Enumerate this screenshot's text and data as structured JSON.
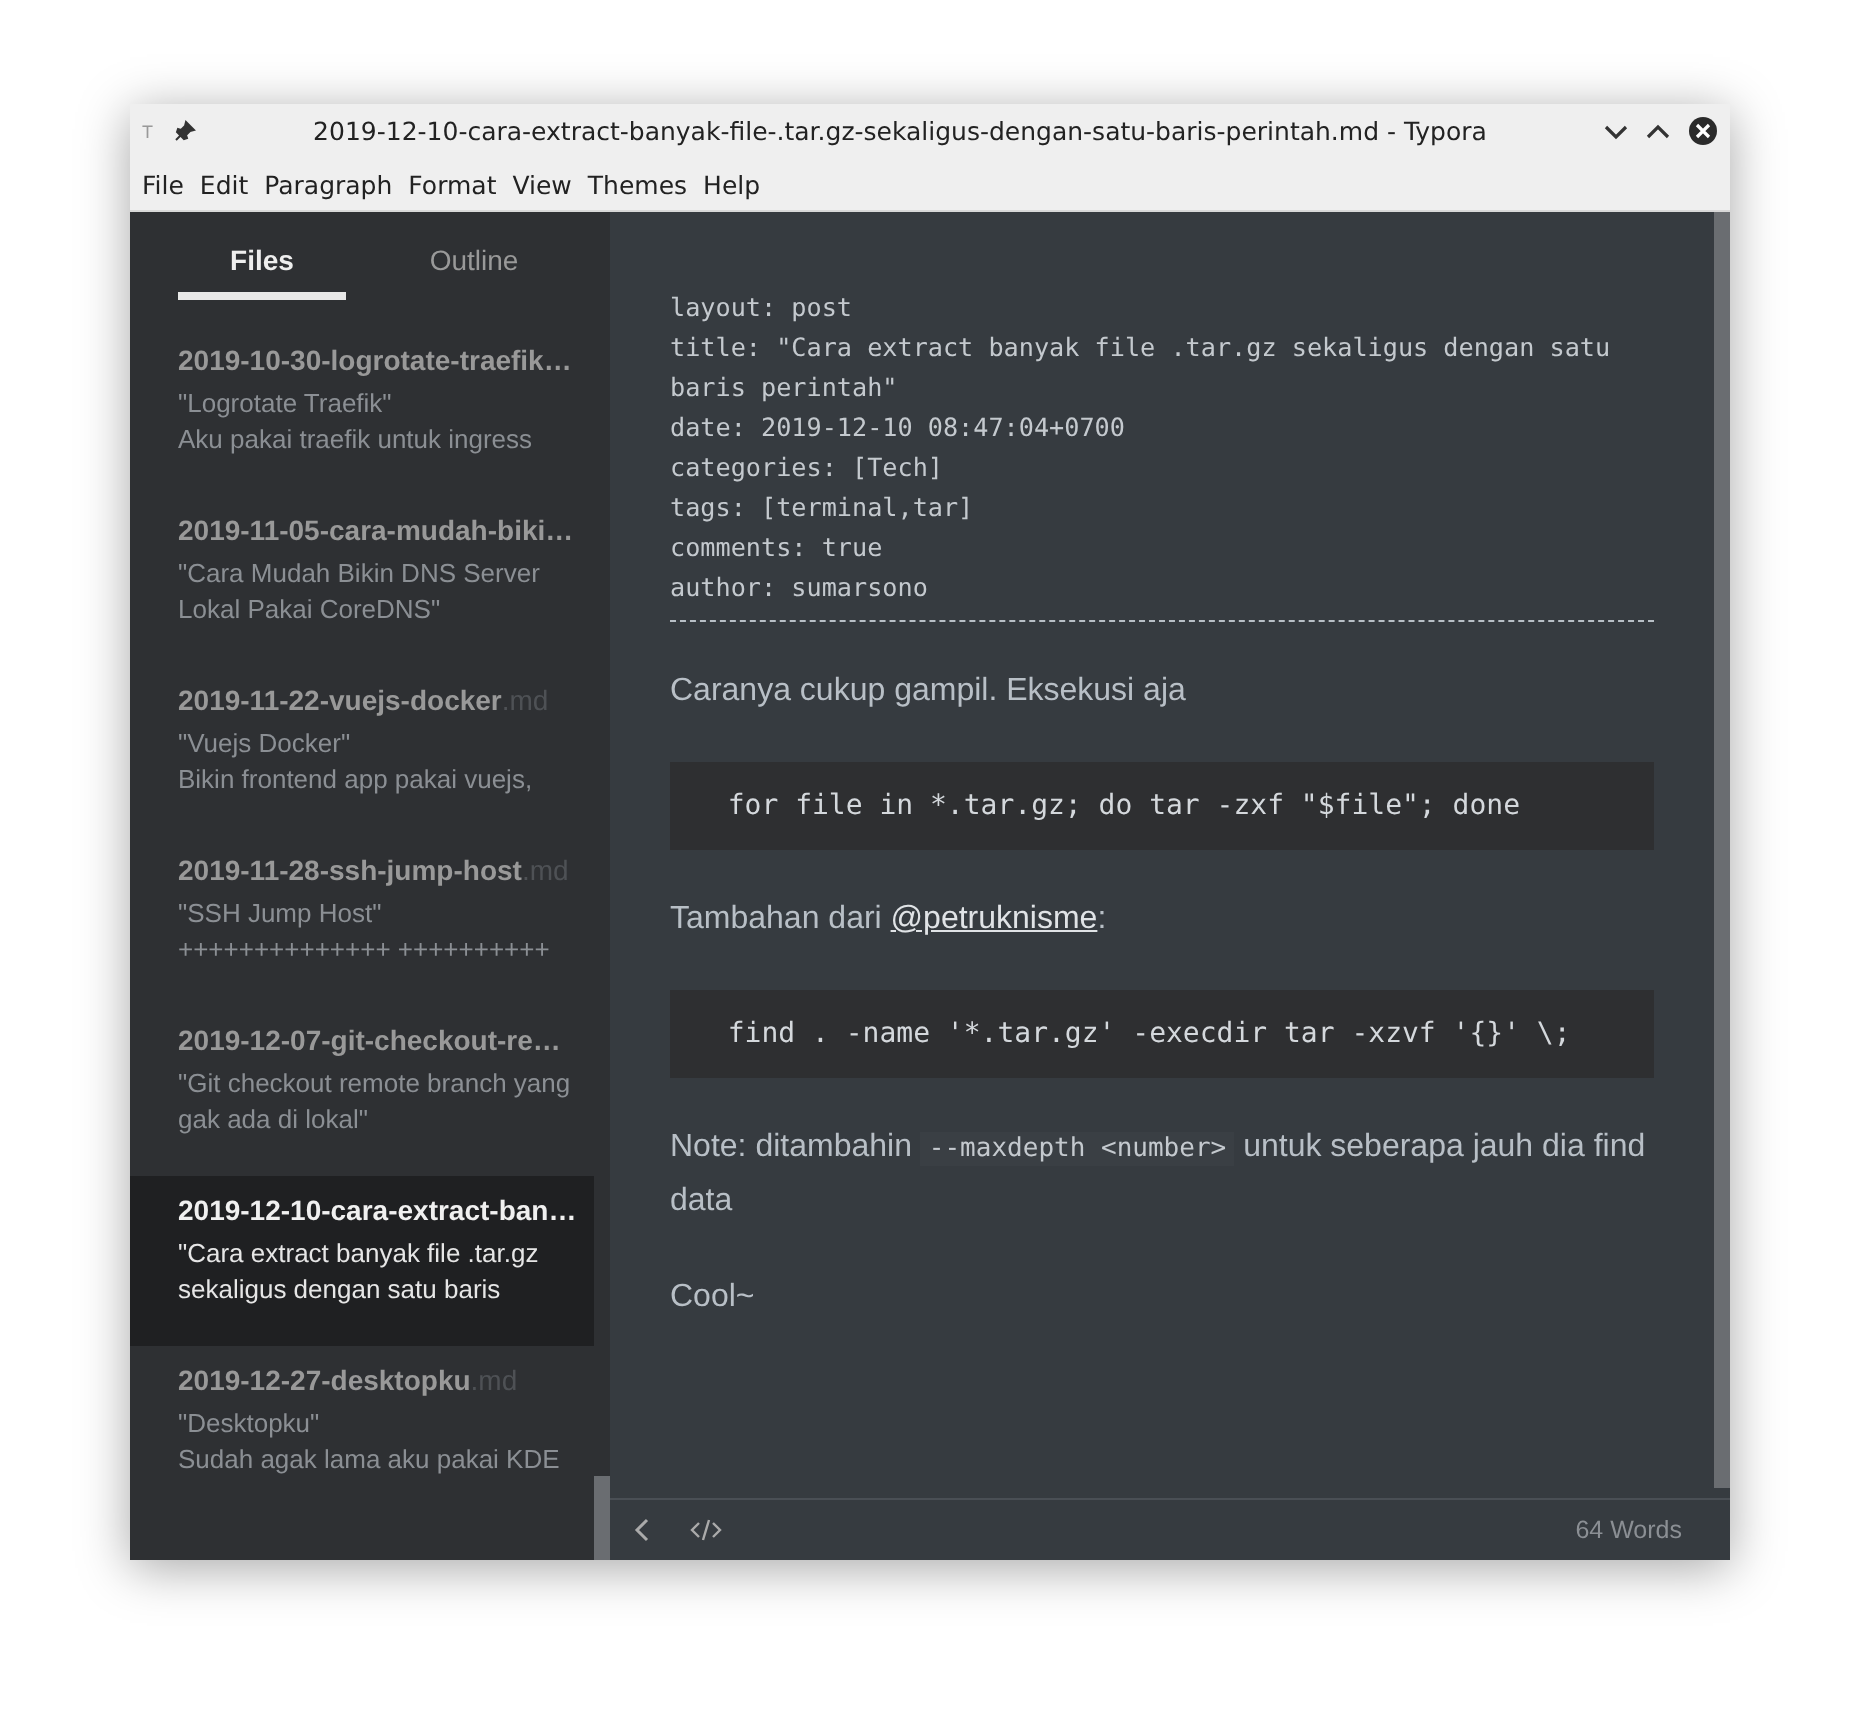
{
  "window": {
    "app_glyph": "T",
    "title": "2019-12-10-cara-extract-banyak-file-.tar.gz-sekaligus-dengan-satu-baris-perintah.md - Typora"
  },
  "menu": [
    "File",
    "Edit",
    "Paragraph",
    "Format",
    "View",
    "Themes",
    "Help"
  ],
  "sidebar": {
    "tabs": [
      {
        "label": "Files",
        "selected": true
      },
      {
        "label": "Outline",
        "selected": false
      }
    ],
    "files": [
      {
        "name": "2019-10-30-logrotate-traefik…",
        "lines": [
          "\"Logrotate Traefik\"",
          "Aku pakai traefik untuk ingress"
        ],
        "selected": false
      },
      {
        "name": "2019-11-05-cara-mudah-biki…",
        "lines": [
          "\"Cara Mudah Bikin DNS Server Lokal Pakai CoreDNS\""
        ],
        "selected": false
      },
      {
        "name": "2019-11-22-vuejs-docker",
        "ext": ".md",
        "lines": [
          "\"Vuejs Docker\"",
          "Bikin frontend app pakai vuejs,"
        ],
        "selected": false
      },
      {
        "name": "2019-11-28-ssh-jump-host",
        "ext": ".md",
        "lines": [
          "\"SSH Jump Host\"",
          "++++++++++++++ ++++++++++"
        ],
        "selected": false
      },
      {
        "name": "2019-12-07-git-checkout-re…",
        "lines": [
          "\"Git checkout remote branch yang gak ada di lokal\""
        ],
        "selected": false
      },
      {
        "name": "2019-12-10-cara-extract-ban…",
        "lines": [
          "\"Cara extract banyak file .tar.gz sekaligus dengan satu baris"
        ],
        "selected": true
      },
      {
        "name": "2019-12-27-desktopku",
        "ext": ".md",
        "lines": [
          "\"Desktopku\"",
          "Sudah agak lama aku pakai KDE"
        ],
        "selected": false
      }
    ]
  },
  "editor": {
    "blocks": [
      {
        "kind": "front_matter",
        "lines": [
          "layout: post",
          "title: \"Cara extract banyak file .tar.gz sekaligus dengan satu baris perintah\"",
          "date: 2019-12-10 08:47:04+0700",
          "categories: [Tech]",
          "tags: [terminal,tar]",
          "comments: true",
          "author: sumarsono"
        ]
      },
      {
        "kind": "paragraph",
        "parts": [
          {
            "kind": "text",
            "text": "Caranya cukup gampil. Eksekusi aja"
          }
        ]
      },
      {
        "kind": "code",
        "text": "  for file in *.tar.gz; do tar -zxf \"$file\"; done"
      },
      {
        "kind": "paragraph",
        "parts": [
          {
            "kind": "text",
            "text": "Tambahan dari "
          },
          {
            "kind": "link",
            "text": "@petruknisme"
          },
          {
            "kind": "text",
            "text": ":"
          }
        ]
      },
      {
        "kind": "code",
        "text": "  find . -name '*.tar.gz' -execdir tar -xzvf '{}' \\;"
      },
      {
        "kind": "paragraph",
        "parts": [
          {
            "kind": "text",
            "text": "Note: ditambahin "
          },
          {
            "kind": "code",
            "text": "--maxdepth <number>"
          },
          {
            "kind": "text",
            "text": " untuk seberapa jauh dia find data"
          }
        ]
      },
      {
        "kind": "paragraph",
        "parts": [
          {
            "kind": "text",
            "text": "Cool~"
          }
        ]
      }
    ]
  },
  "status_bar": {
    "word_count": "64 Words"
  }
}
